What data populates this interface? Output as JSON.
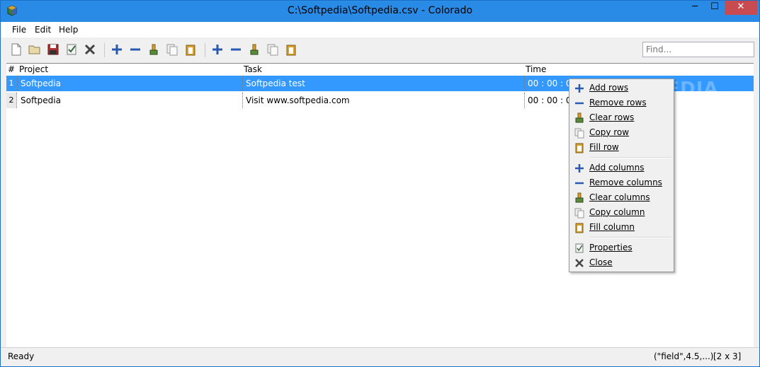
{
  "window": {
    "title": "C:\\Softpedia\\Softpedia.csv - Colorado",
    "minimize": "─",
    "maximize": "☐",
    "close": "✕"
  },
  "menubar": {
    "items": [
      {
        "label": "File"
      },
      {
        "label": "Edit"
      },
      {
        "label": "Help"
      }
    ]
  },
  "toolbar": {
    "find_placeholder": "Find..."
  },
  "grid": {
    "columns": [
      "#",
      "Project",
      "Task",
      "Time"
    ],
    "rows": [
      {
        "num": "1",
        "project": "Softpedia",
        "task": "Softpedia test",
        "time": "00 : 00 : 00",
        "selected": true
      },
      {
        "num": "2",
        "project": "Softpedia",
        "task": "Visit www.softpedia.com",
        "time": "00 : 00 : 00",
        "selected": false
      }
    ]
  },
  "context_menu": {
    "items": [
      {
        "label": "Add rows",
        "icon": "plus-icon"
      },
      {
        "label": "Remove rows",
        "icon": "minus-icon"
      },
      {
        "label": "Clear rows",
        "icon": "eraser-icon"
      },
      {
        "label": "Copy row",
        "icon": "copy-icon"
      },
      {
        "label": "Fill row",
        "icon": "paste-icon"
      },
      {
        "label": "Add columns",
        "icon": "plus-icon"
      },
      {
        "label": "Remove columns",
        "icon": "minus-icon"
      },
      {
        "label": "Clear columns",
        "icon": "eraser-icon"
      },
      {
        "label": "Copy column",
        "icon": "copy-icon"
      },
      {
        "label": "Fill column",
        "icon": "paste-icon"
      },
      {
        "label": "Properties",
        "icon": "properties-icon"
      },
      {
        "label": "Close",
        "icon": "close-icon"
      }
    ]
  },
  "status": {
    "left": "Ready",
    "format": "(\"field\",4.5,...)",
    "size": "[2 x 3]"
  },
  "watermark": "SOFTPEDIA",
  "colors": {
    "titlebar": "#2a8be6",
    "selection": "#3399ff",
    "close_button": "#c74b50"
  }
}
